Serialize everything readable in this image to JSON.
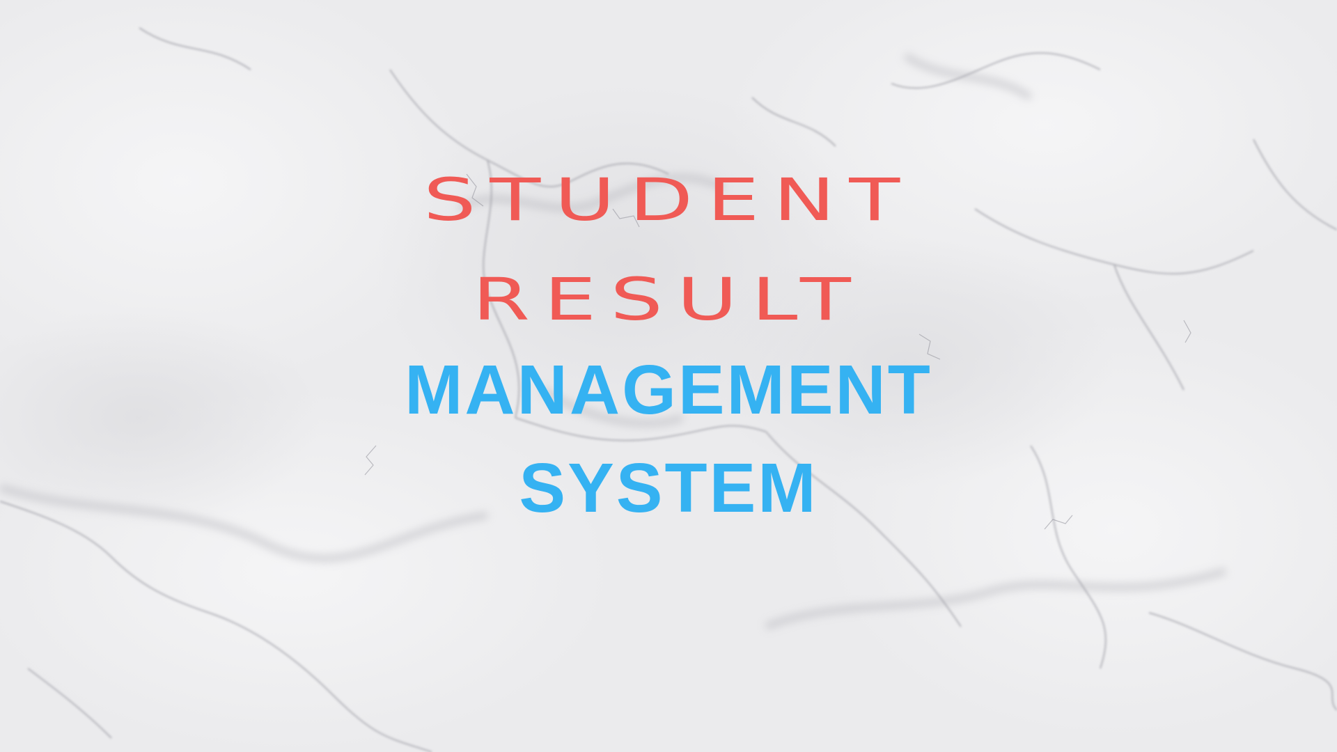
{
  "title": {
    "line1": "STUDENT",
    "line2": "RESULT",
    "line3": "MANAGEMENT",
    "line4": "SYSTEM"
  },
  "colors": {
    "accent_red": "#f05a55",
    "accent_blue": "#35b2f2",
    "background": "#ececee",
    "vein": "#9a9aa2"
  }
}
